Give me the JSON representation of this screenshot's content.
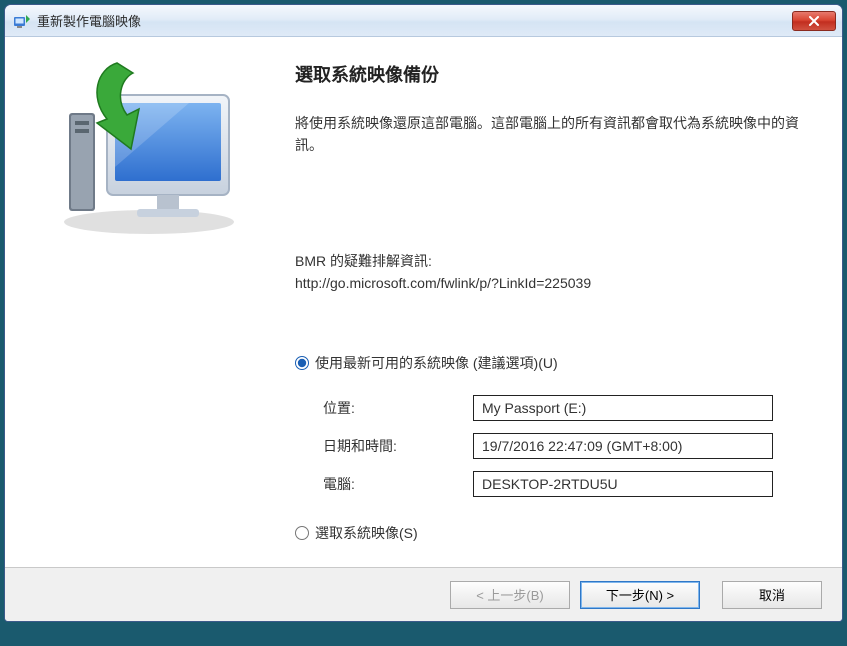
{
  "titlebar": {
    "title": "重新製作電腦映像"
  },
  "main": {
    "heading": "選取系統映像備份",
    "description": "將使用系統映像還原這部電腦。這部電腦上的所有資訊都會取代為系統映像中的資訊。",
    "bmr_label": "BMR 的疑難排解資訊:",
    "bmr_url": "http://go.microsoft.com/fwlink/p/?LinkId=225039",
    "radio_latest": "使用最新可用的系統映像 (建議選項)(U)",
    "radio_select": "選取系統映像(S)",
    "fields": {
      "location_label": "位置:",
      "location_value": "My Passport (E:)",
      "datetime_label": "日期和時間:",
      "datetime_value": "19/7/2016 22:47:09 (GMT+8:00)",
      "computer_label": "電腦:",
      "computer_value": "DESKTOP-2RTDU5U"
    }
  },
  "buttons": {
    "back": "< 上一步(B)",
    "next": "下一步(N) >",
    "cancel": "取消"
  }
}
